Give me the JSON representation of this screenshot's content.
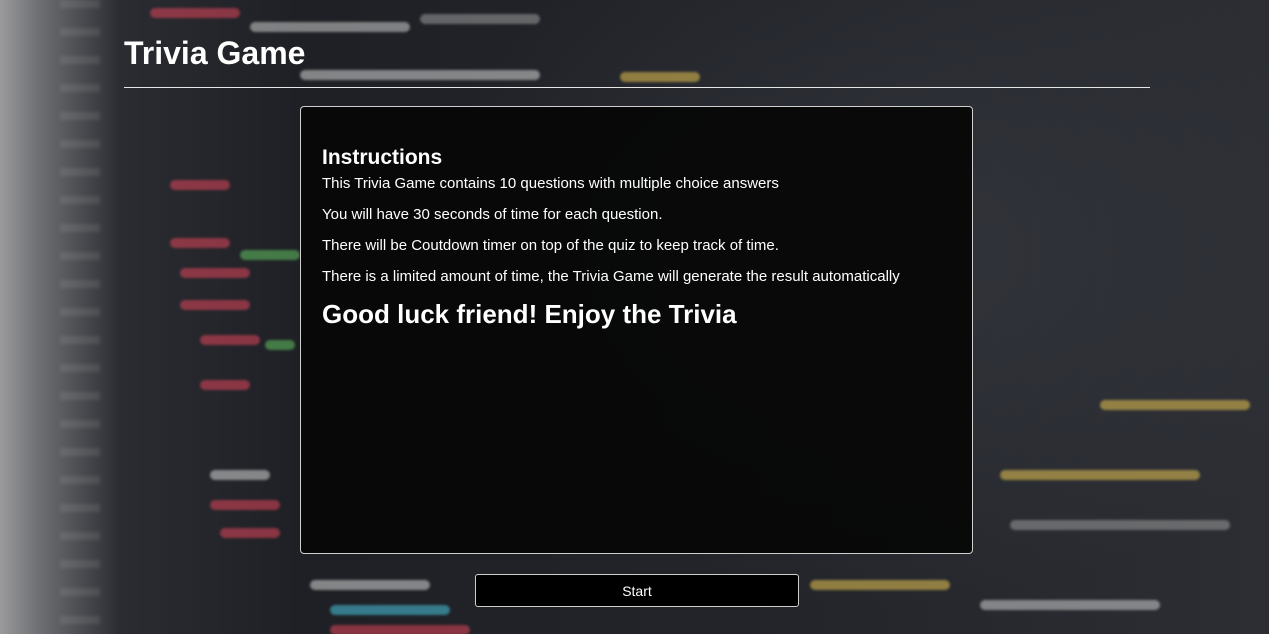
{
  "header": {
    "title": "Trivia Game"
  },
  "instructions": {
    "heading": "Instructions",
    "lines": [
      "This Trivia Game contains 10 questions with multiple choice answers",
      "You will have 30 seconds of time for each question.",
      "There will be Coutdown timer on top of the quiz to keep track of time.",
      "There is a limited amount of time, the Trivia Game will generate the result automatically"
    ],
    "closing": "Good luck friend! Enjoy the Trivia"
  },
  "actions": {
    "start_label": "Start"
  },
  "colors": {
    "panel_background": "#060606",
    "panel_border": "#cfcfcf",
    "text": "#ffffff",
    "button_background": "#000000"
  }
}
